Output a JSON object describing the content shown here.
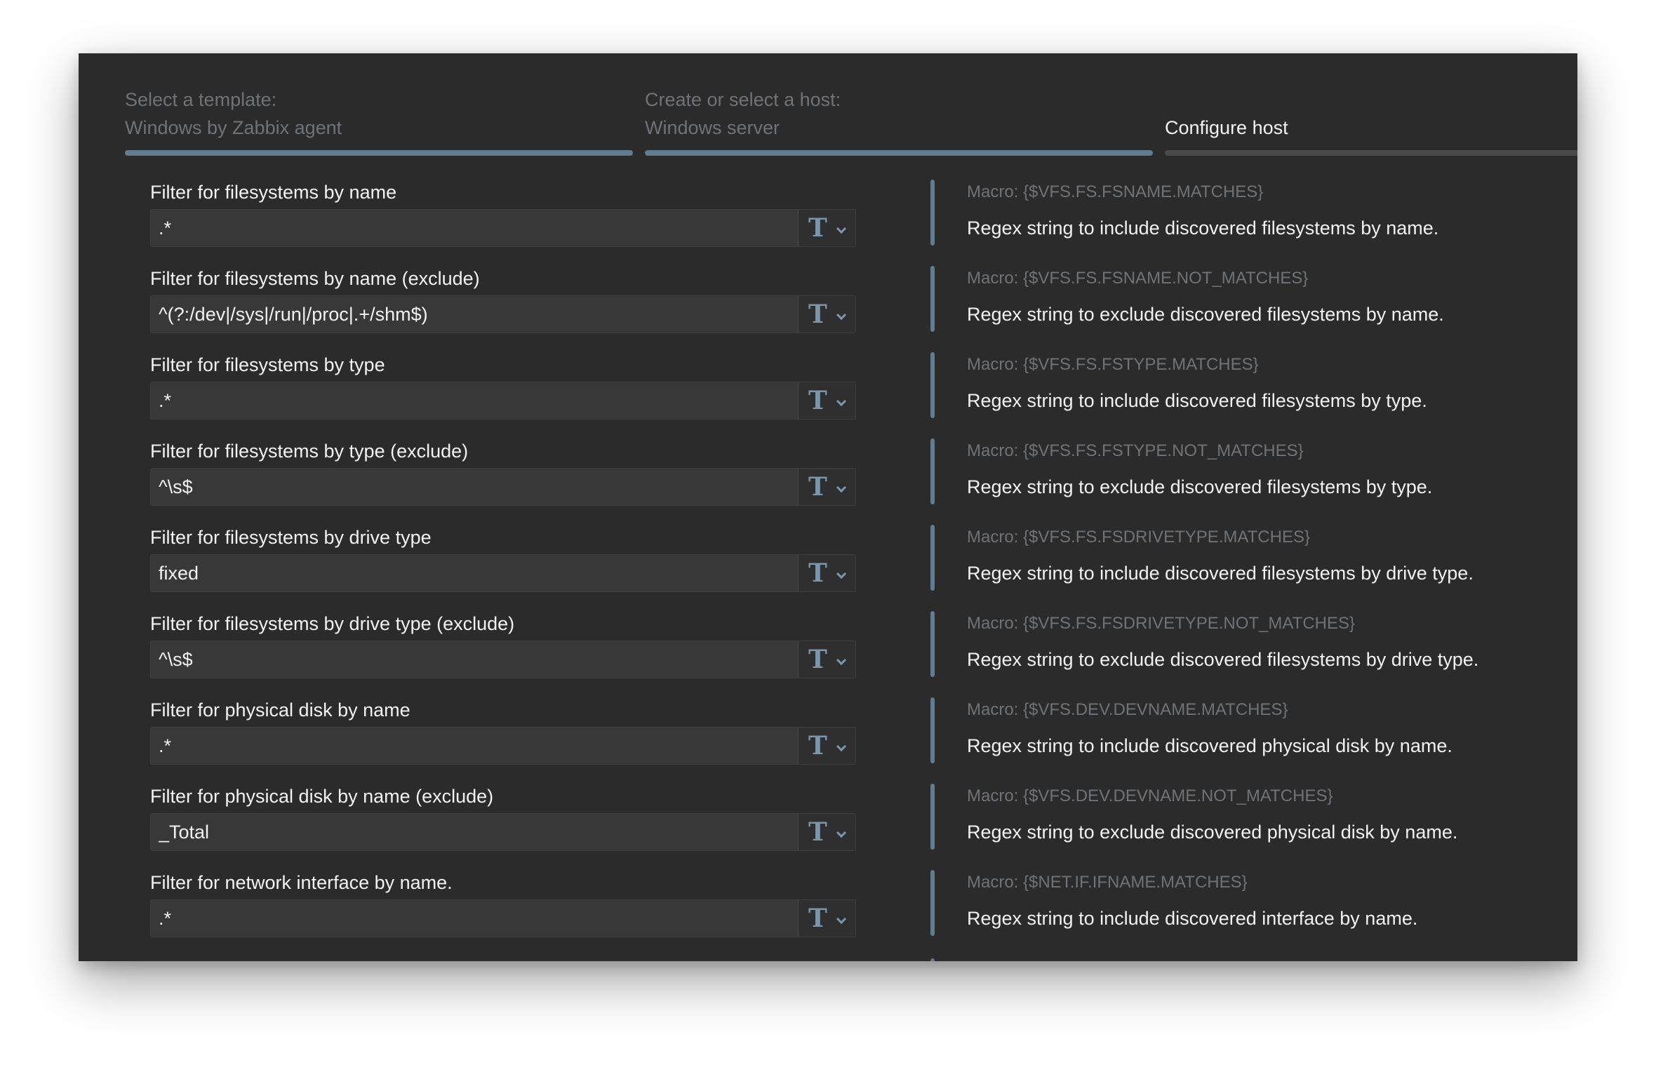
{
  "stepper": {
    "steps": [
      {
        "label": "Select a template:",
        "value": "Windows by Zabbix agent"
      },
      {
        "label": "Create or select a host:",
        "value": "Windows server"
      },
      {
        "label": "",
        "value": "Configure host"
      }
    ]
  },
  "type_button": {
    "glyph": "T",
    "icon": "text-type-icon",
    "chevron_icon": "chevron-down-icon"
  },
  "colors": {
    "accent": "#617c8f",
    "background": "#2b2b2b",
    "text": "#f2f2f2",
    "muted": "#6f7377"
  },
  "rows": [
    {
      "label": "Filter for filesystems by name",
      "value": ".*",
      "macro": "Macro: {$VFS.FS.FSNAME.MATCHES}",
      "description": "Regex string to include discovered filesystems by name."
    },
    {
      "label": "Filter for filesystems by name (exclude)",
      "value": "^(?:/dev|/sys|/run|/proc|.+/shm$)",
      "macro": "Macro: {$VFS.FS.FSNAME.NOT_MATCHES}",
      "description": "Regex string to exclude discovered filesystems by name."
    },
    {
      "label": "Filter for filesystems by type",
      "value": ".*",
      "macro": "Macro: {$VFS.FS.FSTYPE.MATCHES}",
      "description": "Regex string to include discovered filesystems by type."
    },
    {
      "label": "Filter for filesystems by type (exclude)",
      "value": "^\\s$",
      "macro": "Macro: {$VFS.FS.FSTYPE.NOT_MATCHES}",
      "description": "Regex string to exclude discovered filesystems by type."
    },
    {
      "label": "Filter for filesystems by drive type",
      "value": "fixed",
      "macro": "Macro: {$VFS.FS.FSDRIVETYPE.MATCHES}",
      "description": "Regex string to include discovered filesystems by drive type."
    },
    {
      "label": "Filter for filesystems by drive type (exclude)",
      "value": "^\\s$",
      "macro": "Macro: {$VFS.FS.FSDRIVETYPE.NOT_MATCHES}",
      "description": "Regex string to exclude discovered filesystems by drive type."
    },
    {
      "label": "Filter for physical disk by name",
      "value": ".*",
      "macro": "Macro: {$VFS.DEV.DEVNAME.MATCHES}",
      "description": "Regex string to include discovered physical disk by name."
    },
    {
      "label": "Filter for physical disk by name (exclude)",
      "value": "_Total",
      "macro": "Macro: {$VFS.DEV.DEVNAME.NOT_MATCHES}",
      "description": "Regex string to exclude discovered physical disk by name."
    },
    {
      "label": "Filter for network interface by name.",
      "value": ".*",
      "macro": "Macro: {$NET.IF.IFNAME.MATCHES}",
      "description": "Regex string to include discovered interface by name."
    }
  ]
}
